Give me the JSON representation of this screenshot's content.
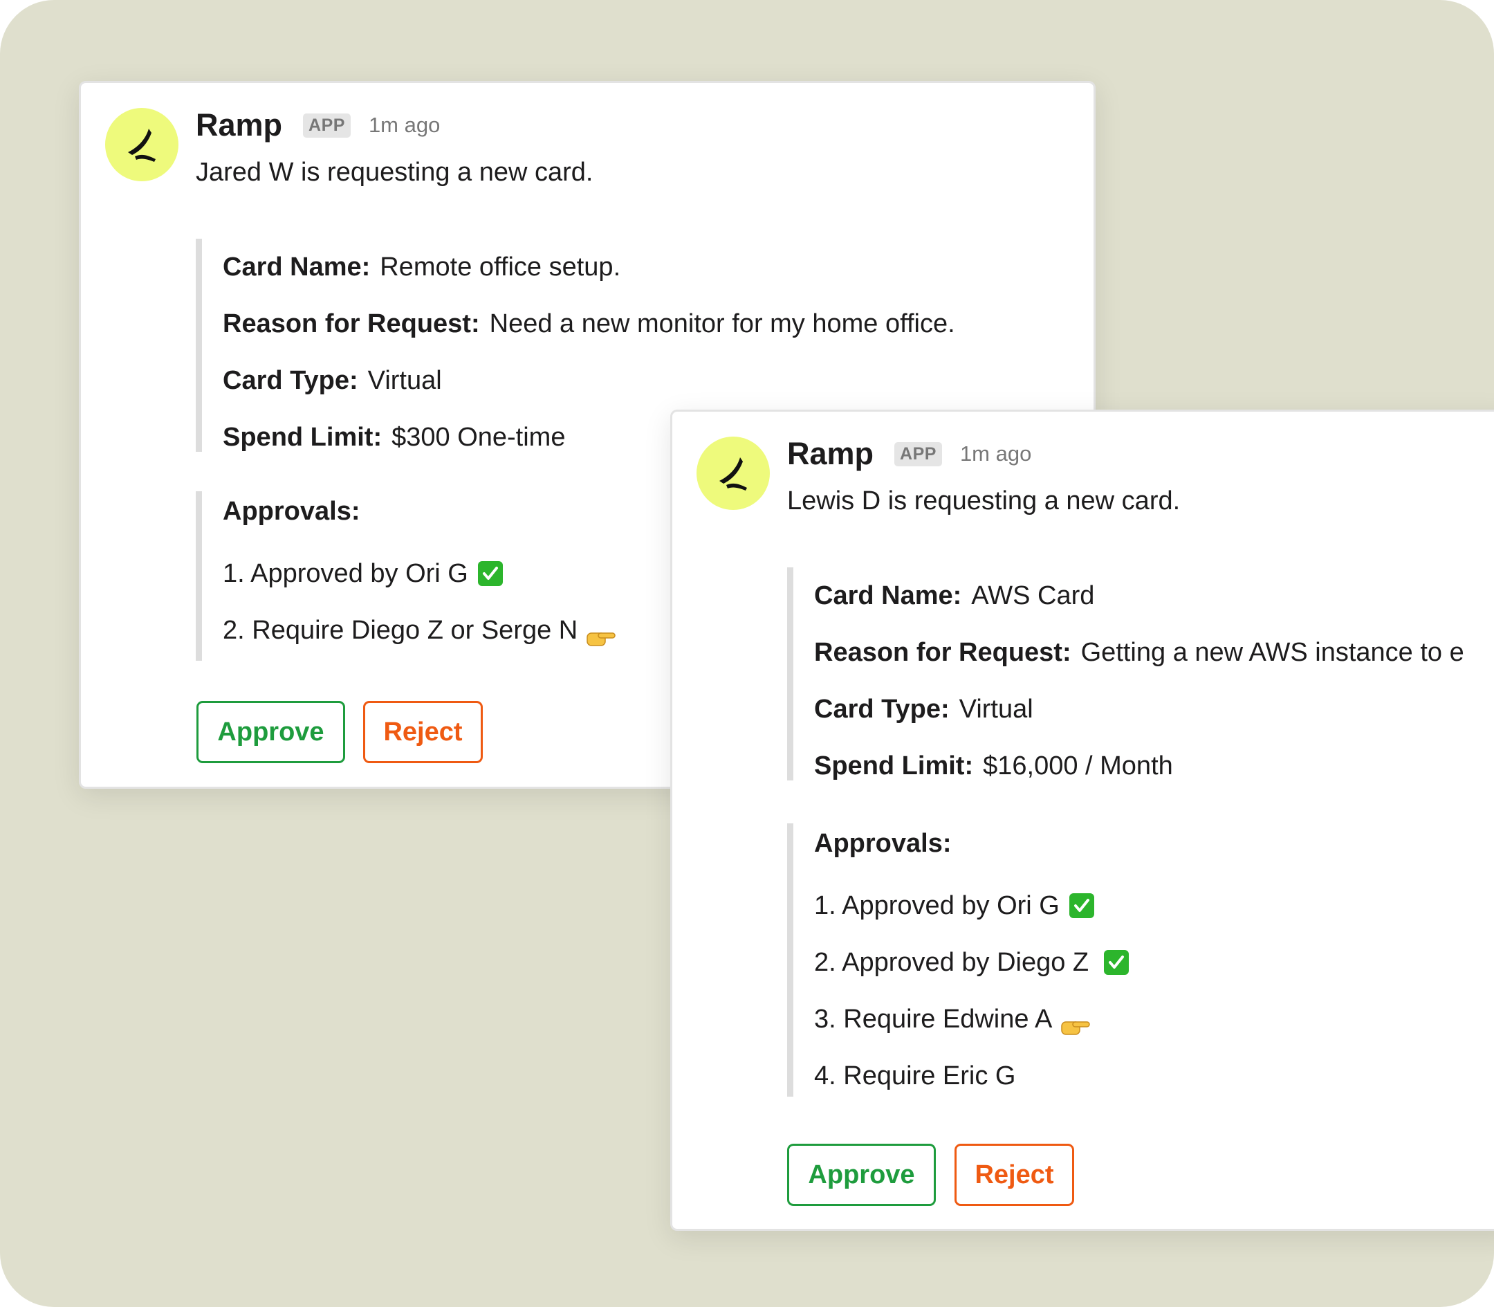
{
  "colors": {
    "background": "#dfdfcd",
    "avatar": "#eefa7c",
    "approve": "#1e9c3d",
    "reject": "#ef5a12",
    "check": "#2cb52c"
  },
  "card1": {
    "app_name": "Ramp",
    "badge": "APP",
    "time": "1m ago",
    "message": "Jared W is requesting a new card.",
    "fields": {
      "card_name_label": "Card Name:",
      "card_name": "Remote office setup.",
      "reason_label": "Reason for Request:",
      "reason": "Need a new monitor for my home office.",
      "type_label": "Card Type:",
      "type": "Virtual",
      "limit_label": "Spend Limit:",
      "limit": "$300 One-time"
    },
    "approvals_title": "Approvals:",
    "approvals": [
      {
        "text": "1. Approved by Ori G",
        "icon": "check-icon"
      },
      {
        "text": "2. Require Diego Z or Serge N",
        "icon": "pointing-hand-icon"
      }
    ],
    "approve_label": "Approve",
    "reject_label": "Reject"
  },
  "card2": {
    "app_name": "Ramp",
    "badge": "APP",
    "time": "1m ago",
    "message": "Lewis D is requesting a new card.",
    "fields": {
      "card_name_label": "Card Name:",
      "card_name": "AWS Card",
      "reason_label": "Reason for Request:",
      "reason": "Getting a new AWS instance to e",
      "type_label": "Card Type:",
      "type": "Virtual",
      "limit_label": "Spend Limit:",
      "limit": "$16,000 / Month"
    },
    "approvals_title": "Approvals:",
    "approvals": [
      {
        "text": "1. Approved by Ori G",
        "icon": "check-icon"
      },
      {
        "text": "2. Approved by Diego Z",
        "icon": "check-icon"
      },
      {
        "text": "3. Require Edwine A",
        "icon": "pointing-hand-icon"
      },
      {
        "text": "4. Require Eric G",
        "icon": ""
      }
    ],
    "approve_label": "Approve",
    "reject_label": "Reject"
  }
}
